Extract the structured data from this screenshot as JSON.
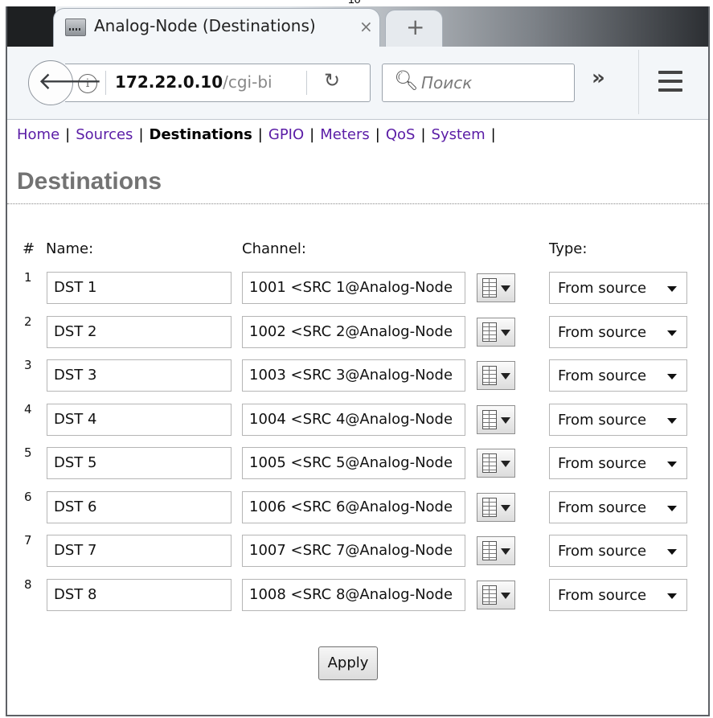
{
  "browser": {
    "tab_title": "Analog-Node (Destinations)",
    "tab_close": "×",
    "new_tab": "+",
    "url_host": "172.22.0.10",
    "url_path": "/cgi-bi",
    "search_placeholder": "Поиск",
    "overflow_label": "»",
    "stray_text": "10"
  },
  "nav": {
    "items": [
      {
        "label": "Home"
      },
      {
        "label": "Sources"
      },
      {
        "label": "Destinations",
        "current": true
      },
      {
        "label": "GPIO"
      },
      {
        "label": "Meters"
      },
      {
        "label": "QoS"
      },
      {
        "label": "System"
      }
    ],
    "separator": "|"
  },
  "page": {
    "title": "Destinations",
    "headers": {
      "num": "#",
      "name": "Name:",
      "channel": "Channel:",
      "type": "Type:"
    },
    "rows": [
      {
        "num": "1",
        "name": "DST 1",
        "channel": "1001 <SRC 1@Analog-Node",
        "type": "From source"
      },
      {
        "num": "2",
        "name": "DST 2",
        "channel": "1002 <SRC 2@Analog-Node",
        "type": "From source"
      },
      {
        "num": "3",
        "name": "DST 3",
        "channel": "1003 <SRC 3@Analog-Node",
        "type": "From source"
      },
      {
        "num": "4",
        "name": "DST 4",
        "channel": "1004 <SRC 4@Analog-Node",
        "type": "From source"
      },
      {
        "num": "5",
        "name": "DST 5",
        "channel": "1005 <SRC 5@Analog-Node",
        "type": "From source"
      },
      {
        "num": "6",
        "name": "DST 6",
        "channel": "1006 <SRC 6@Analog-Node",
        "type": "From source"
      },
      {
        "num": "7",
        "name": "DST 7",
        "channel": "1007 <SRC 7@Analog-Node",
        "type": "From source"
      },
      {
        "num": "8",
        "name": "DST 8",
        "channel": "1008 <SRC 8@Analog-Node",
        "type": "From source"
      }
    ],
    "apply_label": "Apply"
  }
}
